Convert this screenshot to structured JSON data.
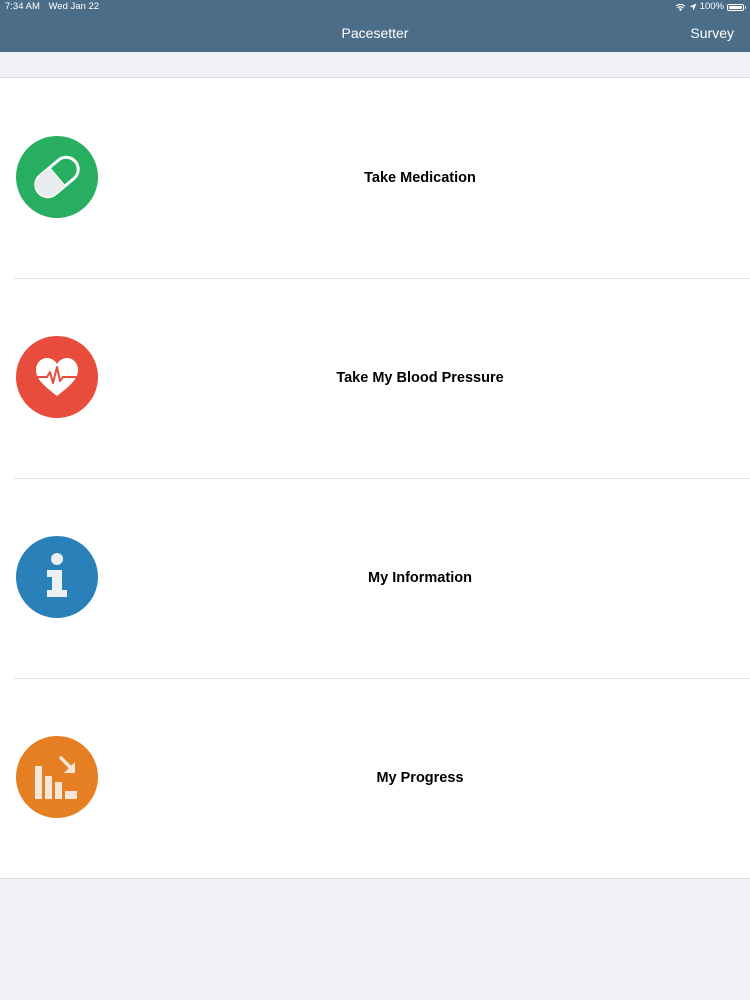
{
  "status_bar": {
    "time": "7:34 AM",
    "date": "Wed Jan 22",
    "battery": "100%"
  },
  "navbar": {
    "title": "Pacesetter",
    "right_button": "Survey"
  },
  "menu": [
    {
      "label": "Take Medication",
      "icon": "pill-icon",
      "color": "#27ae60"
    },
    {
      "label": "Take My Blood Pressure",
      "icon": "heart-pulse-icon",
      "color": "#e74c3c"
    },
    {
      "label": "My Information",
      "icon": "info-icon",
      "color": "#2a80b9"
    },
    {
      "label": "My Progress",
      "icon": "progress-chart-icon",
      "color": "#e67e22"
    }
  ]
}
